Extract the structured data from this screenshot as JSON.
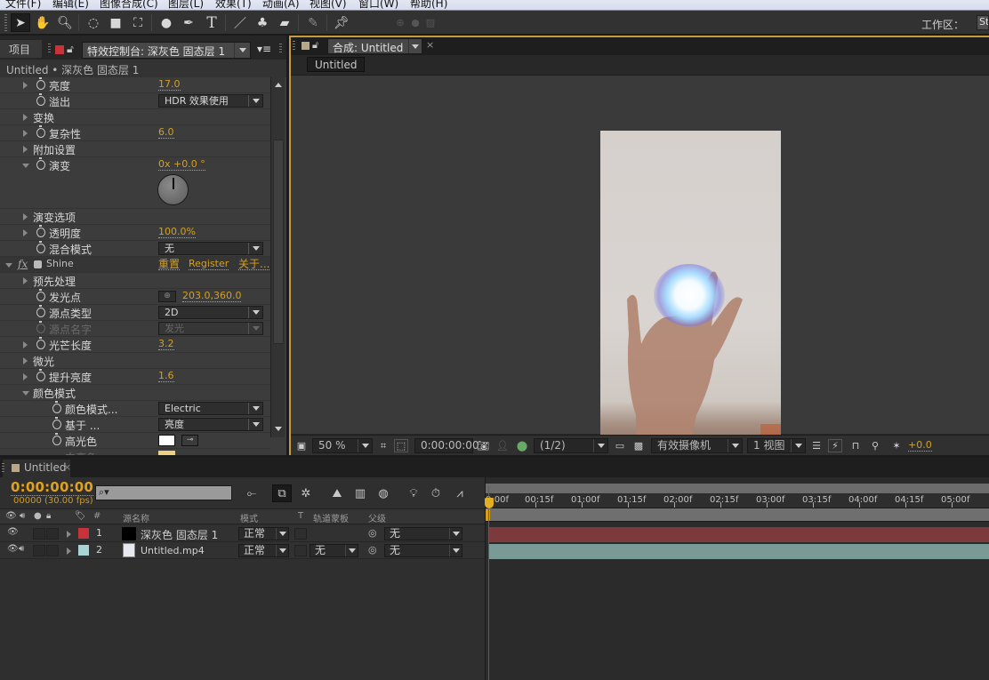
{
  "menu": [
    "文件(F)",
    "编辑(E)",
    "图像合成(C)",
    "图层(L)",
    "效果(T)",
    "动画(A)",
    "视图(V)",
    "窗口(W)",
    "帮助(H)"
  ],
  "toolbar": {
    "tools": [
      "selection-tool",
      "hand-tool",
      "zoom-tool",
      "rotate-tool",
      "camera-tool",
      "pan-behind-tool",
      "shape-tool",
      "pen-tool",
      "type-tool",
      "brush-tool",
      "clone-stamp-tool",
      "eraser-tool",
      "roto-brush-tool",
      "puppet-pin-tool"
    ],
    "workspace_label": "工作区：",
    "workspace_value": "St"
  },
  "effects_panel": {
    "project_tab": "项目",
    "effects_tab": "特效控制台: 深灰色 固态层 1",
    "breadcrumb": "Untitled • 深灰色 固态层 1",
    "properties": [
      {
        "label": "亮度",
        "value": "17.0"
      },
      {
        "label": "溢出",
        "dropdown": "HDR 效果使用"
      },
      {
        "label": "变换"
      },
      {
        "label": "复杂性",
        "value": "6.0"
      },
      {
        "label": "附加设置"
      },
      {
        "label": "演变",
        "value": "0x +0.0 °"
      },
      {
        "label": "演变选项"
      },
      {
        "label": "透明度",
        "value": "100.0%"
      },
      {
        "label": "混合模式",
        "dropdown": "无"
      },
      {
        "label": "Shine",
        "links": [
          "重置",
          "Register",
          "关于..."
        ]
      },
      {
        "label": "预先处理"
      },
      {
        "label": "发光点",
        "value": "203.0,360.0"
      },
      {
        "label": "源点类型",
        "dropdown": "2D"
      },
      {
        "label": "源点名字",
        "dropdown": "发光"
      },
      {
        "label": "光芒长度",
        "value": "3.2"
      },
      {
        "label": "微光"
      },
      {
        "label": "提升亮度",
        "value": "1.6"
      },
      {
        "label": "颜色模式"
      },
      {
        "label": "颜色模式...",
        "dropdown": "Electric"
      },
      {
        "label": "基于 ...",
        "dropdown": "亮度"
      },
      {
        "label": "高光色",
        "color": "#ffffff"
      },
      {
        "label": "中高色",
        "color": "#f0d080"
      }
    ]
  },
  "composition": {
    "tab": "合成: Untitled",
    "sub_tab": "Untitled",
    "zoom": "50 %",
    "timecode": "0:00:00:00",
    "resolution": "(1/2)",
    "camera": "有效摄像机",
    "views": "1 视图",
    "exposure": "+0.0"
  },
  "timeline": {
    "tab": "Untitled",
    "timecode": "0:00:00:00",
    "frame_info": "00000 (30.00 fps)",
    "columns": {
      "source_name": "源名称",
      "mode": "模式",
      "t": "T",
      "track_matte": "轨道蒙板",
      "parent": "父级",
      "number": "#"
    },
    "layers": [
      {
        "index": "1",
        "name": "深灰色 固态层 1",
        "label_color": "#c8323a",
        "mode": "正常",
        "track_matte": "",
        "parent": "无",
        "bar_color": "#7d3a3c"
      },
      {
        "index": "2",
        "name": "Untitled.mp4",
        "label_color": "#a8d4d4",
        "mode": "正常",
        "track_matte": "无",
        "parent": "无",
        "bar_color": "#7a9a96"
      }
    ],
    "ruler_labels": [
      "0:00f",
      "00:15f",
      "01:00f",
      "01:15f",
      "02:00f",
      "02:15f",
      "03:00f",
      "03:15f",
      "04:00f",
      "04:15f",
      "05:00f"
    ]
  }
}
